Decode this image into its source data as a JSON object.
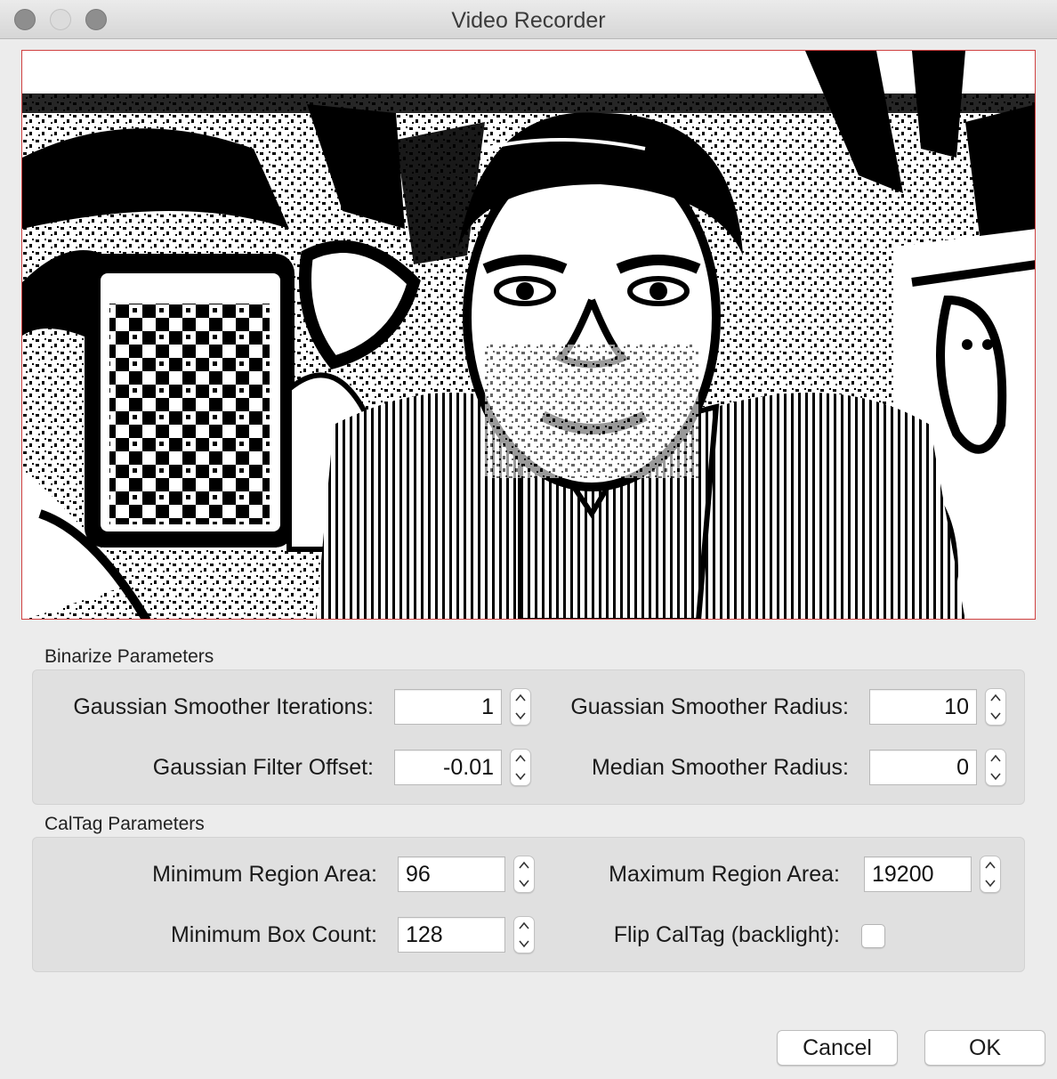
{
  "window": {
    "title": "Video Recorder"
  },
  "binarize": {
    "group_label": "Binarize Parameters",
    "gaussian_iterations_label": "Gaussian Smoother Iterations:",
    "gaussian_iterations_value": "1",
    "gaussian_radius_label": "Guassian Smoother Radius:",
    "gaussian_radius_value": "10",
    "filter_offset_label": "Gaussian Filter Offset:",
    "filter_offset_value": "-0.01",
    "median_radius_label": "Median Smoother Radius:",
    "median_radius_value": "0"
  },
  "caltag": {
    "group_label": "CalTag Parameters",
    "min_region_label": "Minimum Region Area:",
    "min_region_value": "96",
    "max_region_label": "Maximum Region Area:",
    "max_region_value": "19200",
    "min_box_label": "Minimum Box Count:",
    "min_box_value": "128",
    "flip_label": "Flip CalTag (backlight):",
    "flip_checked": false
  },
  "buttons": {
    "cancel": "Cancel",
    "ok": "OK"
  },
  "preview": {
    "description_icon": "binarized-camera-feed"
  }
}
